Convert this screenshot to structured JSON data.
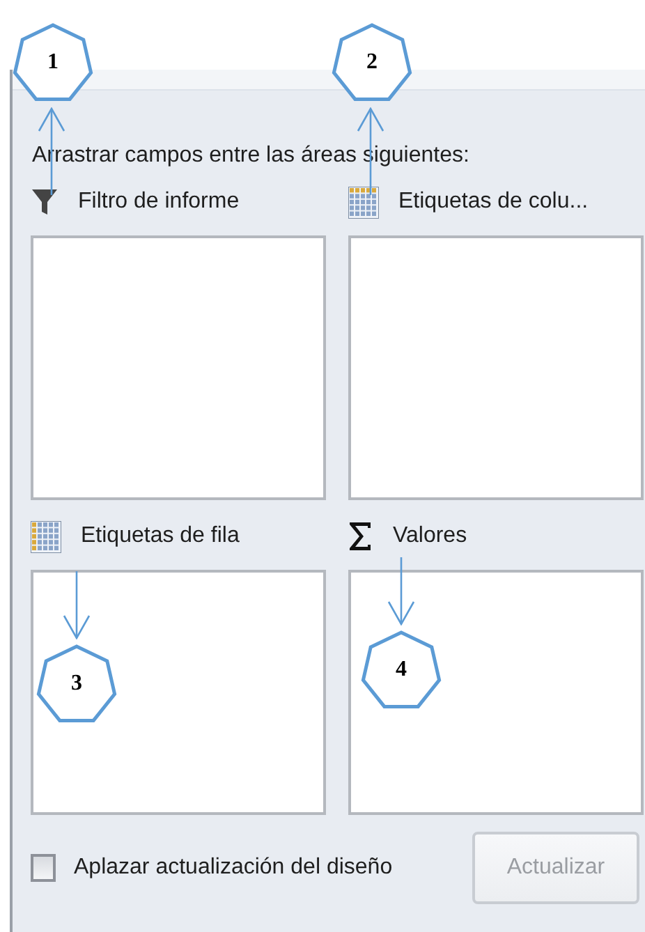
{
  "panel": {
    "instruction": "Arrastrar campos entre las áreas siguientes:",
    "areas": [
      {
        "kind": "filter",
        "label": "Filtro de informe"
      },
      {
        "kind": "columns",
        "label": "Etiquetas de colu..."
      },
      {
        "kind": "rows",
        "label": "Etiquetas de fila"
      },
      {
        "kind": "values",
        "label": "Valores"
      }
    ],
    "defer_update": {
      "label": "Aplazar actualización del diseño",
      "checked": false
    },
    "update_button": {
      "label": "Actualizar",
      "disabled": true
    }
  },
  "annotations": [
    {
      "label": "1"
    },
    {
      "label": "2"
    },
    {
      "label": "3"
    },
    {
      "label": "4"
    }
  ]
}
